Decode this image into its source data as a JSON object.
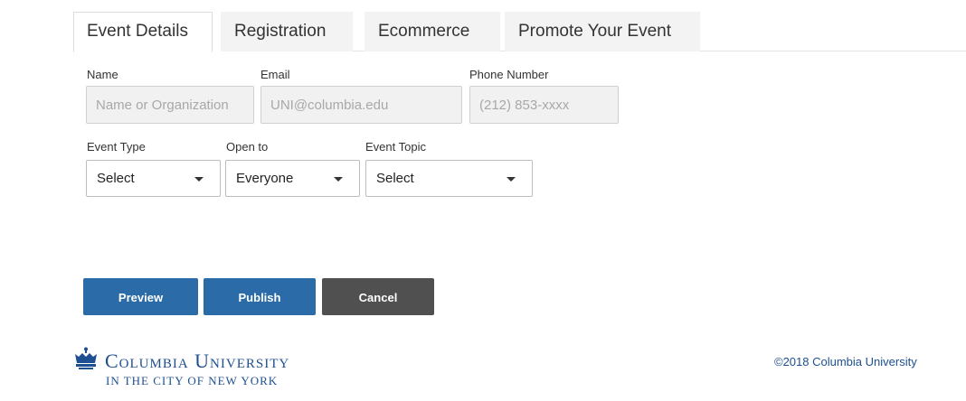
{
  "tabs": [
    {
      "label": "Event Details",
      "active": true
    },
    {
      "label": "Registration",
      "active": false
    },
    {
      "label": "Ecommerce",
      "active": false
    },
    {
      "label": "Promote Your Event",
      "active": false
    }
  ],
  "form": {
    "name": {
      "label": "Name",
      "placeholder": "Name or Organization",
      "value": ""
    },
    "email": {
      "label": "Email",
      "placeholder": "UNI@columbia.edu",
      "value": ""
    },
    "phone": {
      "label": "Phone Number",
      "placeholder": "(212) 853-xxxx",
      "value": ""
    },
    "event_type": {
      "label": "Event Type",
      "value": "Select"
    },
    "open_to": {
      "label": "Open to",
      "value": "Everyone"
    },
    "event_topic": {
      "label": "Event Topic",
      "value": "Select"
    }
  },
  "buttons": {
    "preview": "Preview",
    "publish": "Publish",
    "cancel": "Cancel"
  },
  "footer": {
    "logo_name": "Columbia University",
    "logo_sub": "IN THE CITY OF NEW YORK",
    "copyright": "©2018 Columbia University"
  },
  "colors": {
    "primary_button": "#2b6ca8",
    "cancel_button": "#505050",
    "brand_blue": "#1d4f91"
  }
}
